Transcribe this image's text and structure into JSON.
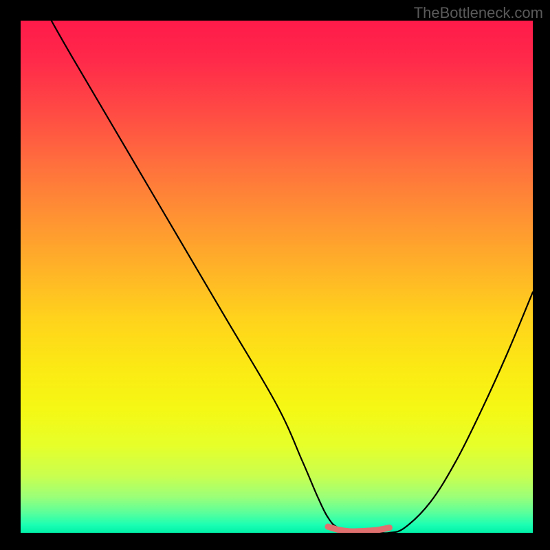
{
  "watermark": "TheBottleneck.com",
  "chart_data": {
    "type": "line",
    "title": "",
    "xlabel": "",
    "ylabel": "",
    "xlim": [
      0,
      100
    ],
    "ylim": [
      0,
      100
    ],
    "series": [
      {
        "name": "curve",
        "x": [
          6,
          10,
          20,
          30,
          40,
          50,
          55,
          58,
          60,
          62,
          66,
          70,
          72,
          75,
          80,
          85,
          90,
          95,
          100
        ],
        "y": [
          100,
          93,
          76,
          59,
          42,
          25,
          14,
          7,
          3,
          1,
          0,
          0,
          0,
          1,
          6,
          14,
          24,
          35,
          47
        ]
      },
      {
        "name": "highlight-segment",
        "color": "#e07070",
        "x": [
          60,
          62,
          64,
          66,
          68,
          70,
          72
        ],
        "y": [
          1.2,
          0.6,
          0.3,
          0.3,
          0.4,
          0.6,
          1.0
        ]
      }
    ],
    "gradient_stops": [
      {
        "pos": 0,
        "color": "#ff1a4a"
      },
      {
        "pos": 50,
        "color": "#ffb128"
      },
      {
        "pos": 80,
        "color": "#f5f814"
      },
      {
        "pos": 100,
        "color": "#00f0a8"
      }
    ]
  }
}
